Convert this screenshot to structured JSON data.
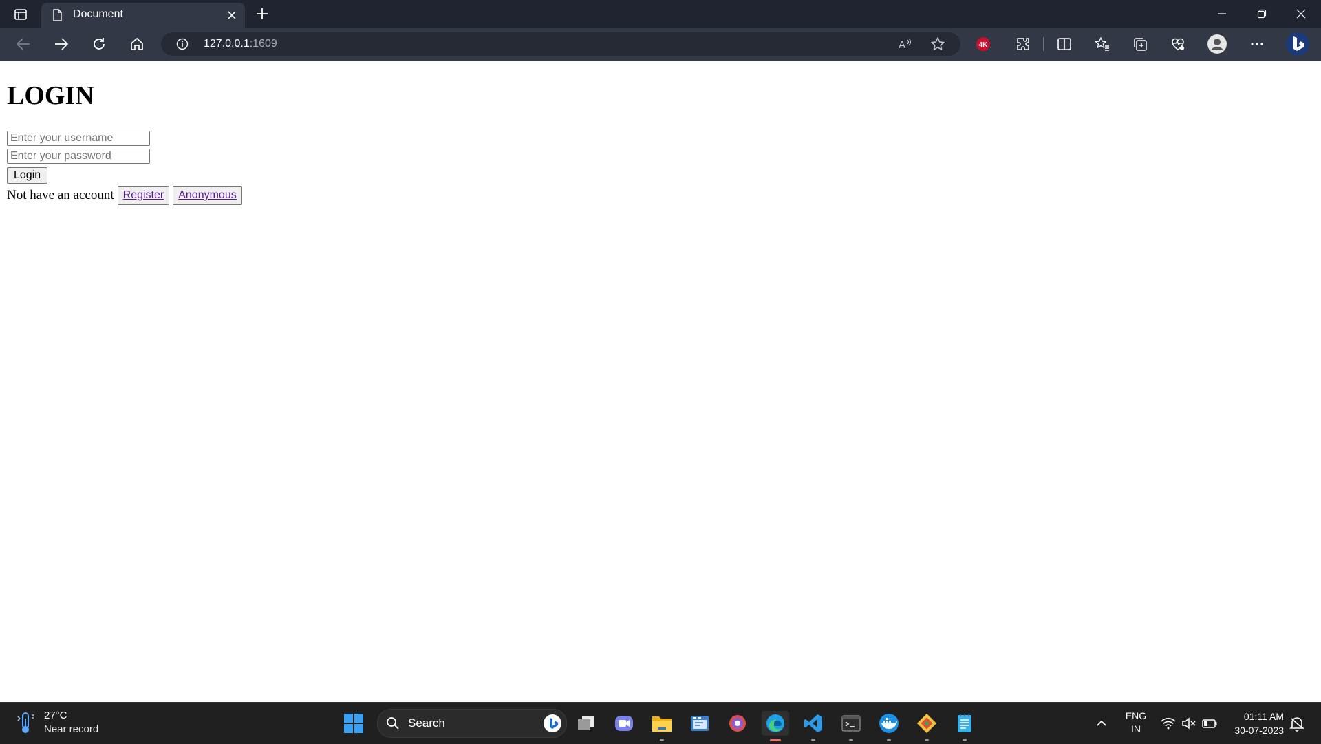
{
  "browser": {
    "tab_title": "Document",
    "url_host": "127.0.0.1",
    "url_port": ":1609"
  },
  "page": {
    "heading": "LOGIN",
    "username_placeholder": "Enter your username",
    "password_placeholder": "Enter your password",
    "login_label": "Login",
    "no_account_text": "Not have an account",
    "register_label": "Register",
    "anonymous_label": "Anonymous"
  },
  "taskbar": {
    "weather_temp": "27°C",
    "weather_desc": "Near record",
    "search_label": "Search",
    "lang_line1": "ENG",
    "lang_line2": "IN",
    "time": "01:11 AM",
    "date": "30-07-2023"
  },
  "icons": [
    "tab-actions-icon",
    "document-icon",
    "close-icon",
    "new-tab-icon",
    "minimize-icon",
    "restore-icon",
    "window-close-icon",
    "back-icon",
    "forward-icon",
    "refresh-icon",
    "home-icon",
    "info-icon",
    "read-aloud-icon",
    "favorite-star-icon",
    "4k-extension-icon",
    "extensions-icon",
    "split-screen-icon",
    "favorites-icon",
    "collections-icon",
    "performance-icon",
    "profile-icon",
    "more-icon",
    "bing-copilot-icon",
    "weather-icon",
    "windows-start-icon",
    "search-icon",
    "task-view-icon",
    "teams-icon",
    "file-explorer-icon",
    "editor-app-icon",
    "browser-app-icon",
    "edge-icon",
    "vscode-icon",
    "terminal-icon",
    "docker-icon",
    "git-icon",
    "notepad-icon",
    "chevron-up-icon",
    "wifi-icon",
    "speaker-muted-icon",
    "battery-icon",
    "notifications-icon"
  ],
  "colors": {
    "chrome_bg": "#1f2430",
    "toolbar_bg": "#323846",
    "taskbar_bg": "#202020",
    "link": "#551a8b"
  }
}
